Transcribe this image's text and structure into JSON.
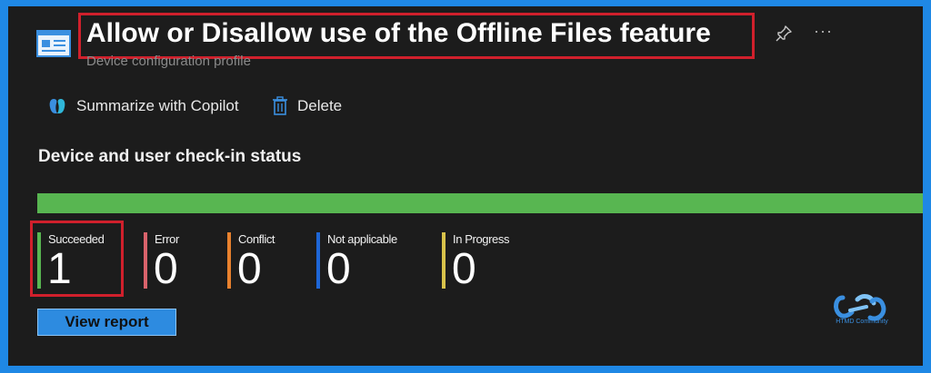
{
  "header": {
    "title": "Allow or Disallow use of the Offline Files feature",
    "subtitle": "Device configuration profile"
  },
  "toolbar": {
    "copilot_label": "Summarize with Copilot",
    "delete_label": "Delete"
  },
  "status": {
    "section_title": "Device and user check-in status",
    "bar_fraction_succeeded": 1.0,
    "items": [
      {
        "label": "Succeeded",
        "value": "1",
        "color": "#58b651"
      },
      {
        "label": "Error",
        "value": "0",
        "color": "#d9636b"
      },
      {
        "label": "Conflict",
        "value": "0",
        "color": "#e8812e"
      },
      {
        "label": "Not applicable",
        "value": "0",
        "color": "#1e66d6"
      },
      {
        "label": "In Progress",
        "value": "0",
        "color": "#d8c24a"
      }
    ]
  },
  "actions": {
    "view_report_label": "View report"
  },
  "watermark": {
    "text": "HTMD Community"
  },
  "colors": {
    "page_background": "#1c1c1c",
    "frame": "#1f88e5",
    "highlight_box": "#d0202c",
    "accent_blue": "#2d8be0"
  }
}
